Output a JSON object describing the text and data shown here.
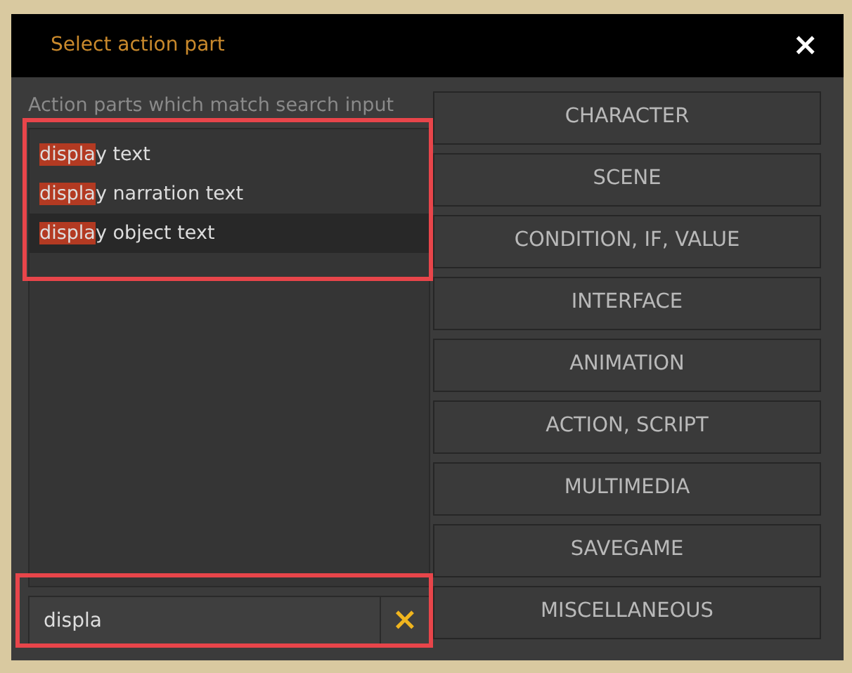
{
  "window": {
    "title": "Select action part",
    "close": "×"
  },
  "results": {
    "annotated": true,
    "label": "Action parts which match search input",
    "items": [
      {
        "match": "displa",
        "rest": "y text",
        "selected": false
      },
      {
        "match": "displa",
        "rest": "y narration text",
        "selected": false
      },
      {
        "match": "displa",
        "rest": "y object text",
        "selected": true
      }
    ]
  },
  "search": {
    "annotated": true,
    "value": "displa",
    "clear": "×"
  },
  "categories": [
    "CHARACTER",
    "SCENE",
    "CONDITION, IF, VALUE",
    "INTERFACE",
    "ANIMATION",
    "ACTION, SCRIPT",
    "MULTIMEDIA",
    "SAVEGAME",
    "MISCELLANEOUS"
  ]
}
